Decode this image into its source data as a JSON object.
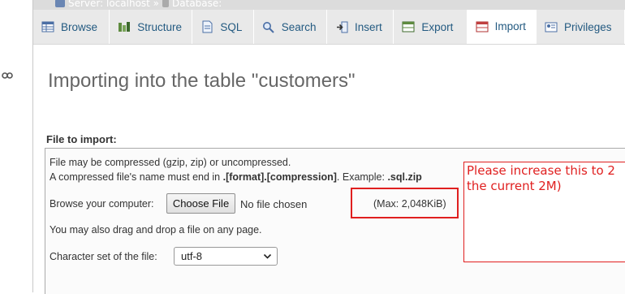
{
  "breadcrumb": {
    "server": "Server: localhost »",
    "database": "Database:"
  },
  "tabs": [
    {
      "label": "Browse",
      "icon": "table-icon"
    },
    {
      "label": "Structure",
      "icon": "structure-icon"
    },
    {
      "label": "SQL",
      "icon": "sql-icon"
    },
    {
      "label": "Search",
      "icon": "search-icon"
    },
    {
      "label": "Insert",
      "icon": "insert-icon"
    },
    {
      "label": "Export",
      "icon": "export-icon"
    },
    {
      "label": "Import",
      "icon": "import-icon"
    },
    {
      "label": "Privileges",
      "icon": "privileges-icon"
    }
  ],
  "page": {
    "title": "Importing into the table \"customers\""
  },
  "file_import": {
    "legend": "File to import:",
    "compress_note": "File may be compressed (gzip, zip) or uncompressed.",
    "name_note_prefix": "A compressed file's name must end in ",
    "name_note_format": ".[format].[compression]",
    "name_note_example_prefix": ". Example: ",
    "name_note_example": ".sql.zip",
    "browse_label": "Browse your computer:",
    "choose_button": "Choose File",
    "no_file": "No file chosen",
    "max_size": "(Max: 2,048KiB)",
    "drag_note": "You may also drag and drop a file on any page.",
    "charset_label": "Character set of the file:",
    "charset_value": "utf-8"
  },
  "annotation": {
    "line1": "Please increase this to 2",
    "line2": "the current 2M)",
    "color": "#e01f1f"
  }
}
